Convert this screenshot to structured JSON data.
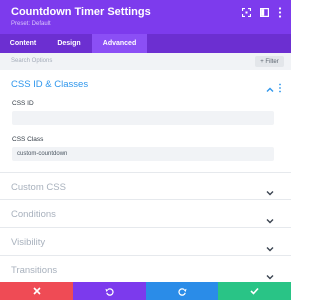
{
  "header": {
    "title": "Countdown Timer Settings",
    "preset": "Preset: Default",
    "icons": [
      "fullscreen-icon",
      "sidebar-toggle-icon",
      "more-options-icon"
    ]
  },
  "tabs": [
    {
      "label": "Content",
      "active": false
    },
    {
      "label": "Design",
      "active": false
    },
    {
      "label": "Advanced",
      "active": true
    }
  ],
  "search": {
    "placeholder": "Search Options",
    "filter_label": "+ Filter"
  },
  "sections": {
    "css": {
      "title": "CSS ID & Classes",
      "expanded": true,
      "fields": [
        {
          "label": "CSS ID",
          "value": ""
        },
        {
          "label": "CSS Class",
          "value": "custom-countdown"
        }
      ]
    },
    "custom_css": {
      "title": "Custom CSS",
      "expanded": false
    },
    "conditions": {
      "title": "Conditions",
      "expanded": false
    },
    "visibility": {
      "title": "Visibility",
      "expanded": false
    },
    "transitions": {
      "title": "Transitions",
      "expanded": false
    }
  },
  "footer": {
    "buttons": [
      {
        "name": "cancel",
        "icon": "close-icon",
        "color": "#ef4b55"
      },
      {
        "name": "undo",
        "icon": "undo-icon",
        "color": "#7c3aed"
      },
      {
        "name": "redo",
        "icon": "redo-icon",
        "color": "#2a8ce8"
      },
      {
        "name": "save",
        "icon": "check-icon",
        "color": "#29c486"
      }
    ]
  },
  "colors": {
    "header_bg": "#7d3bed",
    "tabs_bg": "#6c2fd1",
    "active_tab_bg": "#8b4ff5",
    "section_open": "#2e96ec"
  }
}
